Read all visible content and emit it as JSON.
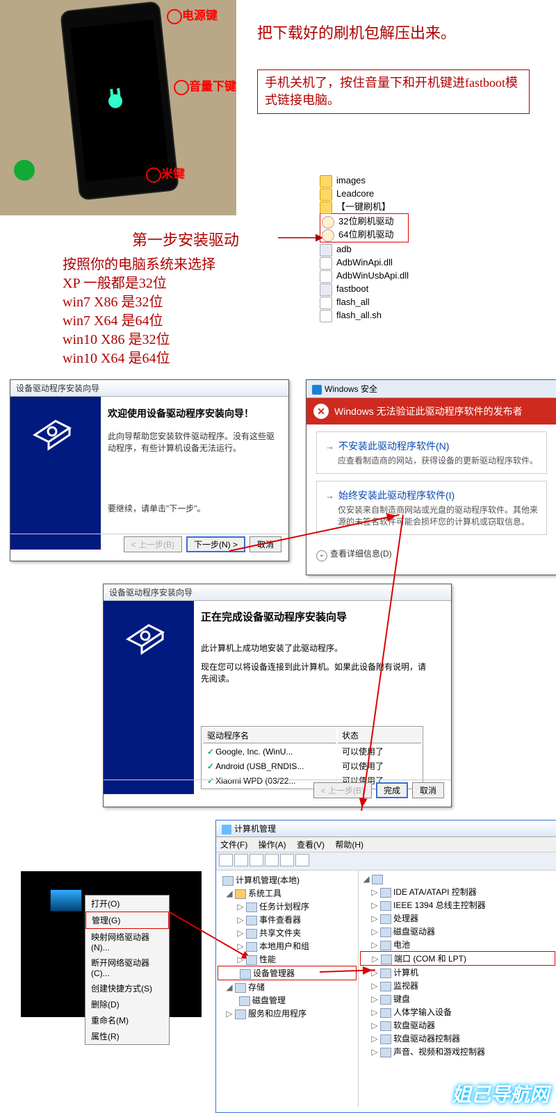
{
  "phone_labels": {
    "power": "电源键",
    "voldown": "音量下键",
    "mi": "米键"
  },
  "top_instr": "把下载好的刷机包解压出来。",
  "boxed_instr": "手机关机了，按住音量下和开机键进fastboot模式链接电脑。",
  "step1": "第一步安装驱动",
  "os_instr": {
    "line1": "按照你的电脑系统来选择",
    "line2": "XP   一般都是32位",
    "line3": "win7  X86  是32位",
    "line4": "win7  X64  是64位",
    "line5": "win10 X86  是32位",
    "line6": "win10 X64  是64位"
  },
  "files": {
    "images": "images",
    "leadcore": "Leadcore",
    "onekey": "【一键刷机】",
    "drv32": "32位刷机驱动",
    "drv64": "64位刷机驱动",
    "adb": "adb",
    "winapi": "AdbWinApi.dll",
    "winusb": "AdbWinUsbApi.dll",
    "fastboot": "fastboot",
    "flash_all": "flash_all",
    "flash_all_sh": "flash_all.sh"
  },
  "wiz1": {
    "title": "设备驱动程序安装向导",
    "heading": "欢迎使用设备驱动程序安装向导！",
    "body": "此向导帮助您安装软件驱动程序。没有这些驱动程序，有些计算机设备无法运行。",
    "cont": "要继续，请单击\"下一步\"。",
    "back": "< 上一步(B)",
    "next": "下一步(N) >",
    "cancel": "取消"
  },
  "sec": {
    "wintitle": "Windows 安全",
    "redbar": "Windows 无法验证此驱动程序软件的发布者",
    "opt1": {
      "lbl": "不安装此驱动程序软件(N)",
      "desc": "应查看制造商的网站，获得设备的更新驱动程序软件。"
    },
    "opt2": {
      "lbl": "始终安装此驱动程序软件(I)",
      "desc": "仅安装来自制造商网站或光盘的驱动程序软件。其他来源的未签名软件可能会损坏您的计算机或窃取信息。"
    },
    "details": "查看详细信息(D)"
  },
  "wiz2": {
    "title": "设备驱动程序安装向导",
    "heading": "正在完成设备驱动程序安装向导",
    "body1": "此计算机上成功地安装了此驱动程序。",
    "body2": "现在您可以将设备连接到此计算机。如果此设备附有说明，请先阅读。",
    "col1": "驱动程序名",
    "col2": "状态",
    "rows": [
      {
        "name": "Google, Inc. (WinU...",
        "status": "可以使用了"
      },
      {
        "name": "Android (USB_RNDIS...",
        "status": "可以使用了"
      },
      {
        "name": "Xiaomi WPD  (03/22...",
        "status": "可以使用了"
      }
    ],
    "back": "< 上一步(B)",
    "finish": "完成",
    "cancel": "取消"
  },
  "ctx": {
    "open": "打开(O)",
    "manage": "管理(G)",
    "map": "映射网络驱动器(N)...",
    "disconnect": "断开网络驱动器(C)...",
    "shortcut": "创建快捷方式(S)",
    "delete": "删除(D)",
    "rename": "重命名(M)",
    "props": "属性(R)"
  },
  "mgmt": {
    "title": "计算机管理",
    "menu": {
      "file": "文件(F)",
      "action": "操作(A)",
      "view": "查看(V)",
      "help": "帮助(H)"
    },
    "root": "计算机管理(本地)",
    "systools": "系统工具",
    "task": "任务计划程序",
    "event": "事件查看器",
    "share": "共享文件夹",
    "users": "本地用户和组",
    "perf": "性能",
    "devmgr": "设备管理器",
    "storage": "存储",
    "disk": "磁盘管理",
    "services": "服务和应用程序",
    "r_ide": "IDE ATA/ATAPI 控制器",
    "r_1394": "IEEE 1394 总线主控制器",
    "r_cpu": "处理器",
    "r_cdrom": "磁盘驱动器",
    "r_batt": "电池",
    "r_ports": "端口 (COM 和 LPT)",
    "r_computer": "计算机",
    "r_monitor": "监视器",
    "r_kbd": "键盘",
    "r_hid": "人体学输入设备",
    "r_floppy": "软盘驱动器",
    "r_floppyctl": "软盘驱动器控制器",
    "r_snd": "声音、视频和游戏控制器"
  },
  "watermark": "姐己导航网"
}
